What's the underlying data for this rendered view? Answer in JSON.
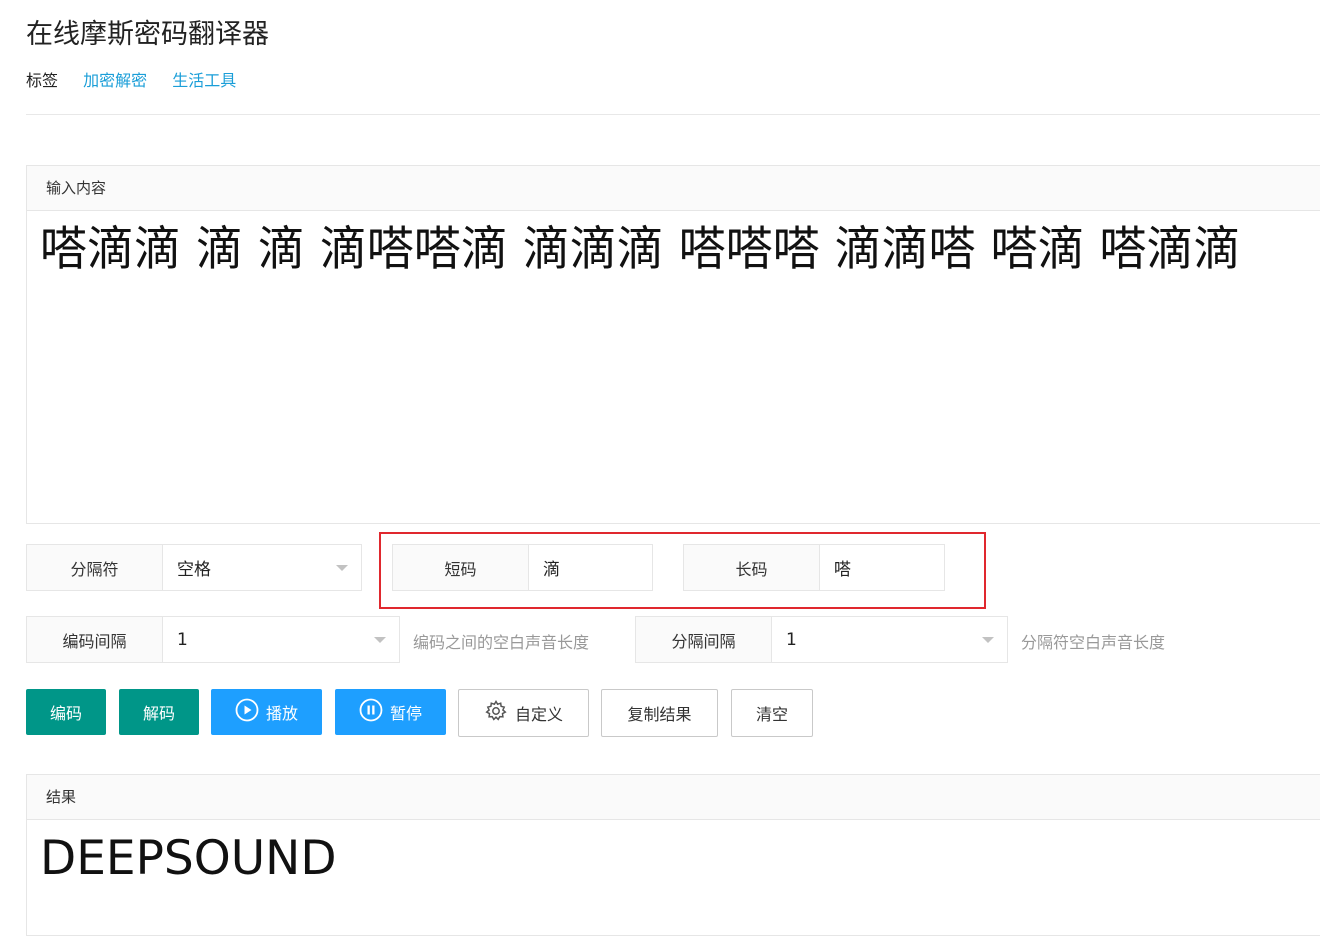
{
  "page": {
    "title": "在线摩斯密码翻译器"
  },
  "tags": {
    "label": "标签",
    "links": [
      "加密解密",
      "生活工具"
    ]
  },
  "input": {
    "header": "输入内容",
    "value": "嗒滴滴 滴 滴 滴嗒嗒滴 滴滴滴 嗒嗒嗒 滴滴嗒 嗒滴 嗒滴滴"
  },
  "separator": {
    "label": "分隔符",
    "value": "空格"
  },
  "short_code": {
    "label": "短码",
    "value": "滴"
  },
  "long_code": {
    "label": "长码",
    "value": "嗒"
  },
  "code_interval": {
    "label": "编码间隔",
    "value": "1",
    "hint": "编码之间的空白声音长度"
  },
  "separator_interval": {
    "label": "分隔间隔",
    "value": "1",
    "hint": "分隔符空白声音长度"
  },
  "buttons": {
    "encode": "编码",
    "decode": "解码",
    "play": "播放",
    "pause": "暂停",
    "custom": "自定义",
    "copy": "复制结果",
    "clear": "清空"
  },
  "result": {
    "header": "结果",
    "value": "DEEPSOUND"
  },
  "colors": {
    "green": "#009688",
    "blue": "#1e9fff",
    "link": "#1a9ed8",
    "highlight": "#e0282e"
  }
}
